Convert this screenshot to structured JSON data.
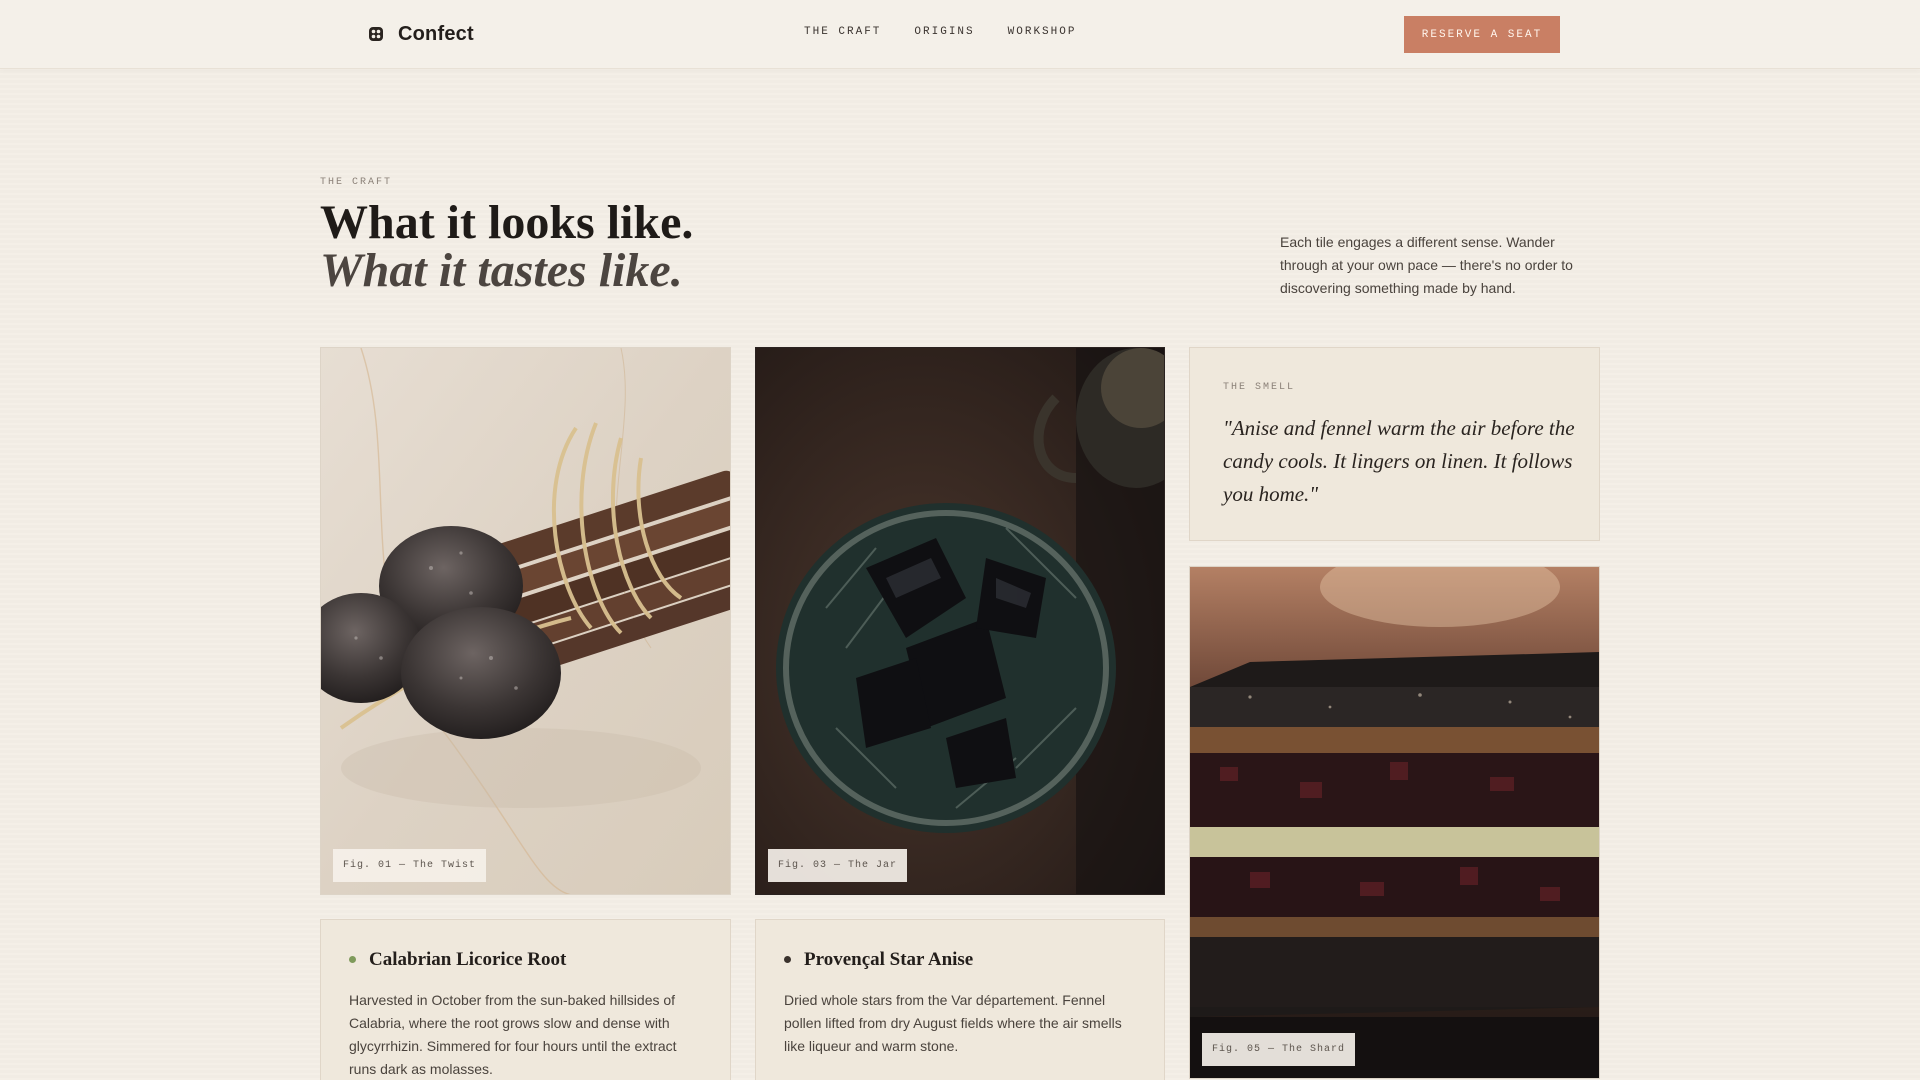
{
  "header": {
    "brand": "Confect",
    "nav": [
      "THE CRAFT",
      "ORIGINS",
      "WORKSHOP"
    ],
    "cta": "RESERVE A SEAT"
  },
  "intro": {
    "eyebrow": "THE CRAFT",
    "headline_1": "What it looks like.",
    "headline_2": "What it tastes like.",
    "description": "Each tile engages a different sense. Wander through at your own pace — there's no order to discovering something made by hand."
  },
  "tiles": {
    "twist": {
      "caption": "Fig. 01 — The Twist"
    },
    "jar": {
      "caption": "Fig. 03 — The Jar"
    },
    "shard": {
      "caption": "Fig. 05 — The Shard"
    },
    "smell": {
      "eyebrow": "THE SMELL",
      "quote": "\"Anise and fennel warm the air before the candy cools. It lingers on linen. It follows you home.\""
    },
    "licorice": {
      "title": "Calabrian Licorice Root",
      "body": "Harvested in October from the sun-baked hillsides of Calabria, where the root grows slow and dense with glycyrrhizin. Simmered for four hours until the extract runs dark as molasses.",
      "dot_color": "#7f9a5b"
    },
    "anise": {
      "title": "Provençal Star Anise",
      "body": "Dried whole stars from the Var département. Fennel pollen lifted from dry August fields where the air smells like liqueur and warm stone.",
      "dot_color": "#3a322d"
    }
  },
  "colors": {
    "background": "#f3eee6",
    "accent": "#c97f64",
    "card": "#efe8dc"
  }
}
